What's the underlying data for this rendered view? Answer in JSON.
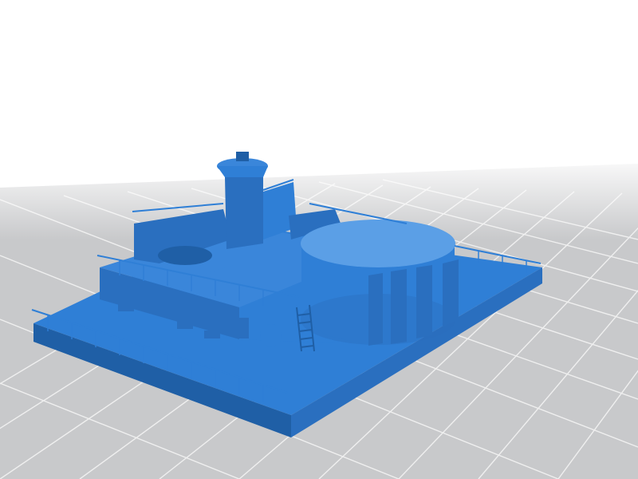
{
  "scene": {
    "background_color": "#ffffff",
    "floor_color": "#c8c9cb",
    "grid_color": "#ffffff",
    "model_color": "#2f7fd6",
    "model_shade": "#1f5fa6",
    "model_highlight": "#5b9fe6"
  }
}
